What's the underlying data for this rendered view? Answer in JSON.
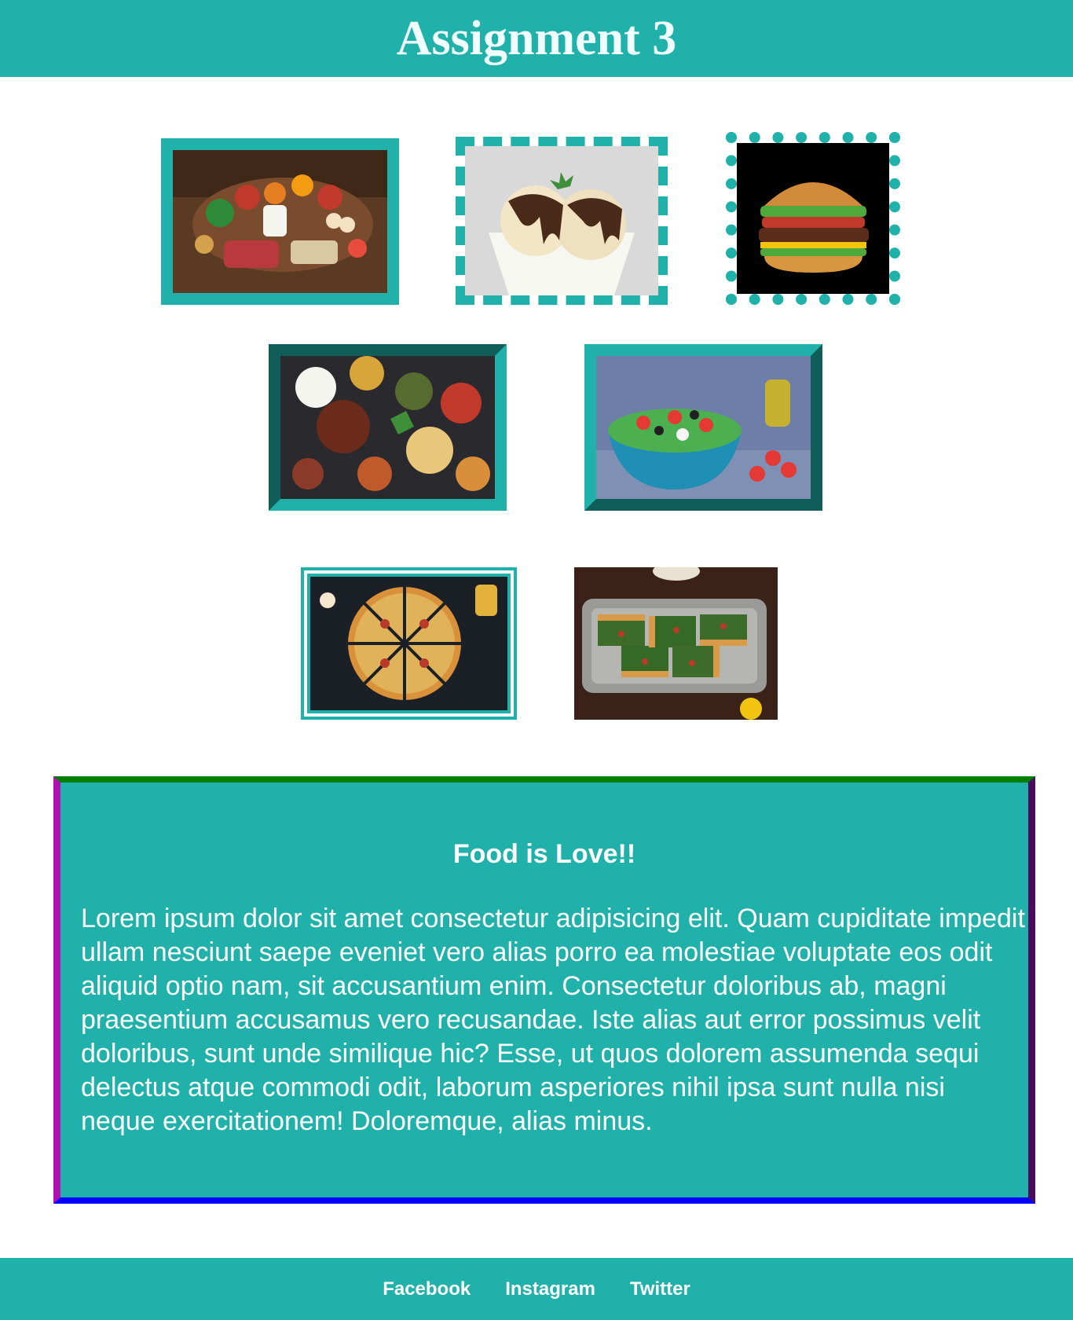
{
  "header": {
    "title": "Assignment 3"
  },
  "gallery": {
    "images": [
      {
        "name": "groceries-image",
        "frame": "solid"
      },
      {
        "name": "ice-cream-image",
        "frame": "dashed"
      },
      {
        "name": "burger-image",
        "frame": "dotted"
      },
      {
        "name": "indian-feast-image",
        "frame": "inset"
      },
      {
        "name": "salad-image",
        "frame": "outset"
      },
      {
        "name": "pizza-image",
        "frame": "double"
      },
      {
        "name": "spinach-pastry-image",
        "frame": "none"
      }
    ]
  },
  "section": {
    "heading": "Food is Love!!",
    "paragraph": "Lorem ipsum dolor sit amet consectetur adipisicing elit. Quam cupiditate impedit ullam nesciunt saepe eveniet vero alias porro ea molestiae voluptate eos odit aliquid optio nam, sit accusantium enim. Consectetur doloribus ab, magni praesentium accusamus vero recusandae. Iste alias aut error possimus velit doloribus, sunt unde similique hic? Esse, ut quos dolorem assumenda sequi delectus atque commodi odit, laborum asperiores nihil ipsa sunt nulla nisi neque exercitationem! Doloremque, alias minus."
  },
  "footer": {
    "links": [
      "Facebook",
      "Instagram",
      "Twitter"
    ]
  },
  "colors": {
    "accent": "#20b2aa",
    "title_text": "#f0ffff",
    "border_top": "#008000",
    "border_left": "#b20fb2",
    "border_right": "#4b0b5f",
    "border_bottom": "#0000ff"
  }
}
